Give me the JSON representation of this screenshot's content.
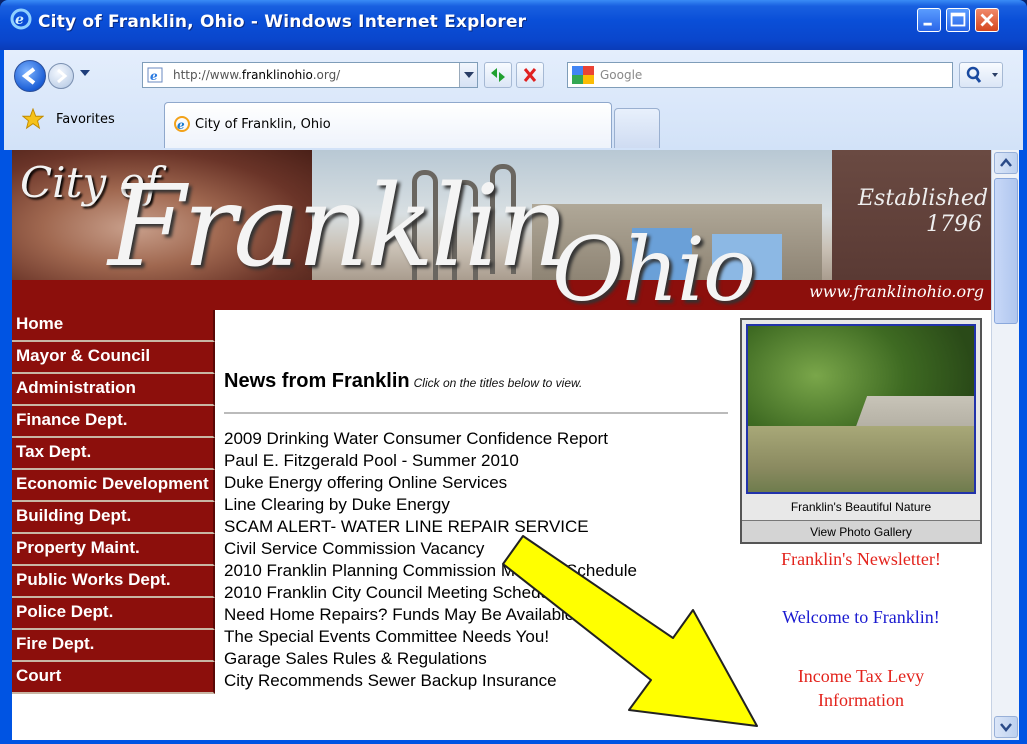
{
  "window": {
    "title": "City of Franklin, Ohio - Windows Internet Explorer"
  },
  "toolbar": {
    "address_prefix": "http://www.",
    "address_domain": "franklinohio",
    "address_suffix": ".org/",
    "search_placeholder": "Google"
  },
  "tabs": {
    "favorites_label": "Favorites",
    "active_tab_label": "City of Franklin, Ohio"
  },
  "banner": {
    "city_of": "City of",
    "franklin": "Franklin",
    "ohio": "Ohio",
    "established": "Established",
    "year": "1796",
    "url": "www.franklinohio.org"
  },
  "nav": {
    "items": [
      "Home",
      "Mayor & Council",
      "Administration",
      "Finance Dept.",
      "Tax Dept.",
      "Economic Development",
      "Building Dept.",
      "Property Maint.",
      "Public Works Dept.",
      "Police Dept.",
      "Fire Dept.",
      "Court"
    ]
  },
  "news": {
    "title": "News from Franklin",
    "subtitle": "Click on the titles below to view.",
    "items": [
      "2009 Drinking Water Consumer Confidence Report",
      "Paul E. Fitzgerald Pool - Summer 2010",
      "Duke Energy offering Online Services",
      "Line Clearing by Duke Energy",
      "SCAM ALERT- WATER LINE REPAIR SERVICE",
      "Civil Service Commission Vacancy",
      "2010 Franklin Planning Commission Meeting Schedule",
      "2010 Franklin City Council Meeting Schedule",
      "Need Home Repairs? Funds May Be Available",
      "The Special Events Committee Needs You!",
      "Garage Sales Rules & Regulations",
      "City Recommends Sewer Backup Insurance"
    ]
  },
  "sidebar": {
    "photo_caption": "Franklin's Beautiful Nature",
    "photo_link": "View Photo Gallery",
    "newsletter": "Franklin's Newsletter!",
    "welcome": "Welcome to Franklin!",
    "tax_levy_line1": "Income Tax Levy",
    "tax_levy_line2": "Information"
  },
  "colors": {
    "nav_bg": "#8c0f0c",
    "link_red": "#e3231c",
    "link_blue": "#1a1ad0",
    "arrow_fill": "#ffff00"
  }
}
